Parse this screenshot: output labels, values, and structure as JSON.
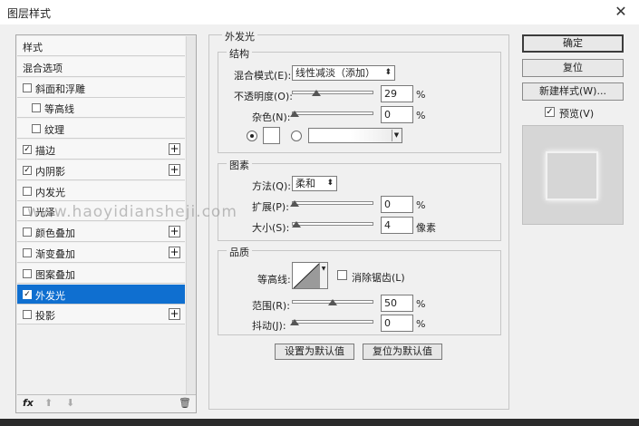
{
  "window": {
    "title": "图层样式",
    "close": "✕"
  },
  "left": {
    "items": [
      {
        "label": "样式",
        "checkbox": false,
        "checked": false,
        "plus": false,
        "selected": false
      },
      {
        "label": "混合选项",
        "checkbox": false,
        "checked": false,
        "plus": false,
        "selected": false
      },
      {
        "label": "斜面和浮雕",
        "checkbox": true,
        "checked": false,
        "plus": false,
        "selected": false
      },
      {
        "label": "等高线",
        "checkbox": true,
        "checked": false,
        "plus": false,
        "selected": false,
        "indent": true
      },
      {
        "label": "纹理",
        "checkbox": true,
        "checked": false,
        "plus": false,
        "selected": false,
        "indent": true
      },
      {
        "label": "描边",
        "checkbox": true,
        "checked": true,
        "plus": true,
        "selected": false
      },
      {
        "label": "内阴影",
        "checkbox": true,
        "checked": true,
        "plus": true,
        "selected": false
      },
      {
        "label": "内发光",
        "checkbox": true,
        "checked": false,
        "plus": false,
        "selected": false
      },
      {
        "label": "光泽",
        "checkbox": true,
        "checked": false,
        "plus": false,
        "selected": false
      },
      {
        "label": "颜色叠加",
        "checkbox": true,
        "checked": false,
        "plus": true,
        "selected": false
      },
      {
        "label": "渐变叠加",
        "checkbox": true,
        "checked": false,
        "plus": true,
        "selected": false
      },
      {
        "label": "图案叠加",
        "checkbox": true,
        "checked": false,
        "plus": false,
        "selected": false
      },
      {
        "label": "外发光",
        "checkbox": true,
        "checked": true,
        "plus": false,
        "selected": true
      },
      {
        "label": "投影",
        "checkbox": true,
        "checked": false,
        "plus": true,
        "selected": false
      }
    ],
    "footer": {
      "fx": "fx",
      "up": "⬆",
      "down": "⬇",
      "trash": "🗑"
    }
  },
  "mid": {
    "section_title": "外发光",
    "structure": {
      "legend": "结构",
      "blend_label": "混合模式(E):",
      "blend_value": "线性减淡（添加）",
      "opacity_label": "不透明度(O):",
      "opacity_value": "29",
      "opacity_unit": "%",
      "opacity_level": 0.29,
      "noise_label": "杂色(N):",
      "noise_value": "0",
      "noise_unit": "%",
      "noise_level": 0
    },
    "elements": {
      "legend": "图素",
      "method_label": "方法(Q):",
      "method_value": "柔和",
      "spread_label": "扩展(P):",
      "spread_value": "0",
      "spread_unit": "%",
      "spread_level": 0,
      "size_label": "大小(S):",
      "size_value": "4",
      "size_unit": "像素",
      "size_level": 0.02
    },
    "quality": {
      "legend": "品质",
      "contour_label": "等高线:",
      "antialias_label": "消除锯齿(L)",
      "range_label": "范围(R):",
      "range_value": "50",
      "range_unit": "%",
      "range_level": 0.5,
      "jitter_label": "抖动(J):",
      "jitter_value": "0",
      "jitter_unit": "%",
      "jitter_level": 0
    },
    "buttons": {
      "make_default": "设置为默认值",
      "reset_default": "复位为默认值"
    }
  },
  "right": {
    "ok": "确定",
    "reset": "复位",
    "new_style": "新建样式(W)...",
    "preview_label": "预览(V)",
    "preview_checked": true
  },
  "watermark": "www.haoyidiansheji.com",
  "colors": {
    "selection": "#0f6fd0",
    "preview_bg": "#d6d6d6"
  }
}
